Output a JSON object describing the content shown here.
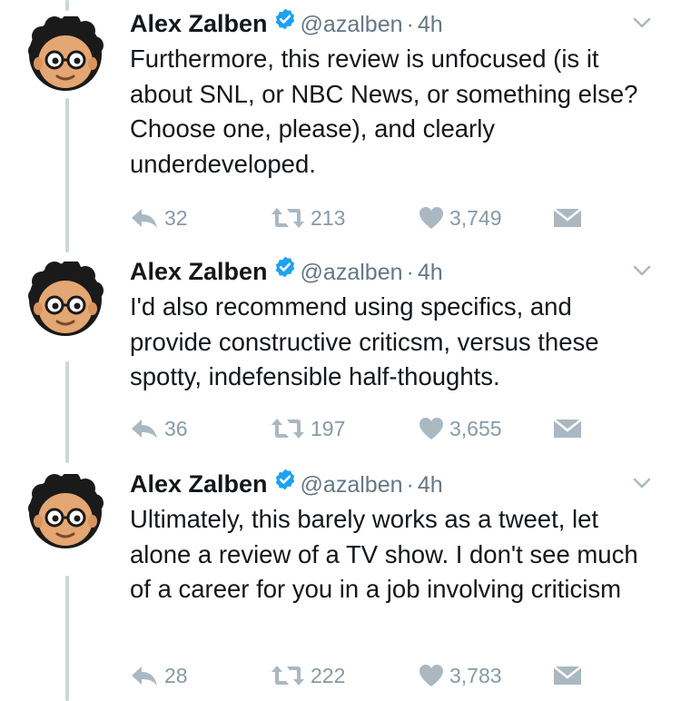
{
  "tweets": [
    {
      "name": "Alex Zalben",
      "handle": "@azalben",
      "separator": "·",
      "time": "4h",
      "text": "Furthermore, this review is unfocused (is it about SNL, or NBC News, or something else? Choose one, please), and clearly underdeveloped.",
      "reply_count": "32",
      "retweet_count": "213",
      "like_count": "3,749"
    },
    {
      "name": "Alex Zalben",
      "handle": "@azalben",
      "separator": "·",
      "time": "4h",
      "text": "I'd also recommend using specifics, and provide constructive criticsm, versus these spotty, indefensible half-thoughts.",
      "reply_count": "36",
      "retweet_count": "197",
      "like_count": "3,655"
    },
    {
      "name": "Alex Zalben",
      "handle": "@azalben",
      "separator": "·",
      "time": "4h",
      "text": "Ultimately, this barely works as a tweet, let alone a review of a TV show. I don't see much of a career for you in a job involving criticism",
      "reply_count": "28",
      "retweet_count": "222",
      "like_count": "3,783"
    }
  ],
  "icons": {
    "verified": "verified-badge-icon",
    "caret": "chevron-down-icon",
    "reply": "reply-icon",
    "retweet": "retweet-icon",
    "like": "heart-icon",
    "dm": "envelope-icon"
  },
  "colors": {
    "verified": "#1da1f2",
    "icon_gray": "#aab8c2",
    "thread_line": "#ccd6dd",
    "avatar_skin": "#e4a672",
    "avatar_hair": "#1a1a1a"
  }
}
